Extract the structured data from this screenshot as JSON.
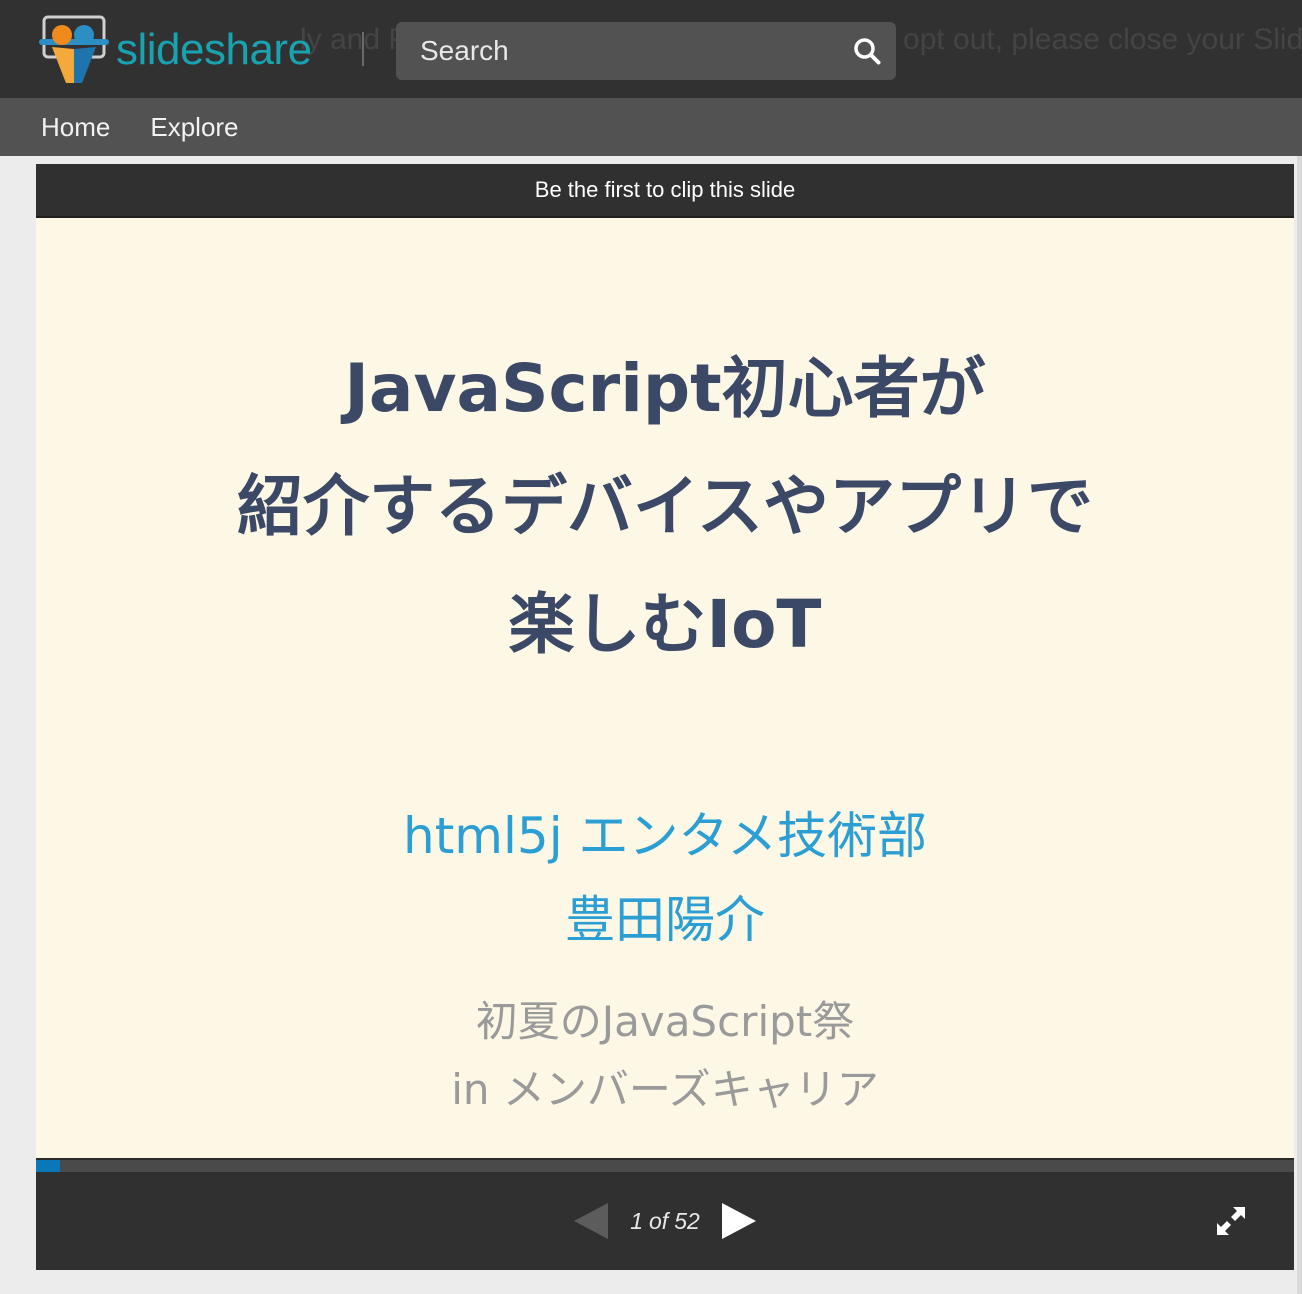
{
  "header": {
    "background_text": "ly and Privacy Policy will apply. If you wish to opt out, please close your Slide",
    "logo_text": "slideshare",
    "search": {
      "placeholder": "Search"
    }
  },
  "nav": {
    "items": [
      {
        "label": "Home"
      },
      {
        "label": "Explore"
      }
    ]
  },
  "player": {
    "clip_label": "Be the first to clip this slide",
    "slide": {
      "title_lines": [
        "JavaScript初心者が",
        "紹介するデバイスやアプリで",
        "楽しむIoT"
      ],
      "author_lines": [
        "html5j エンタメ技術部",
        "豊田陽介"
      ],
      "event_lines": [
        "初夏のJavaScript祭",
        "in メンバーズキャリア"
      ]
    },
    "pagination": {
      "current": "1",
      "of_label": "of",
      "total": "52"
    },
    "progress_fraction": 0.0192
  },
  "colors": {
    "brand": "#18a3b0",
    "progress": "#0a78b8",
    "title": "#3b4866",
    "author": "#2b9fd3"
  },
  "icons": {
    "logo": "slideshare-logo-icon",
    "search": "search-icon",
    "prev": "triangle-left-icon",
    "next": "triangle-right-icon",
    "fullscreen": "expand-arrows-icon"
  }
}
